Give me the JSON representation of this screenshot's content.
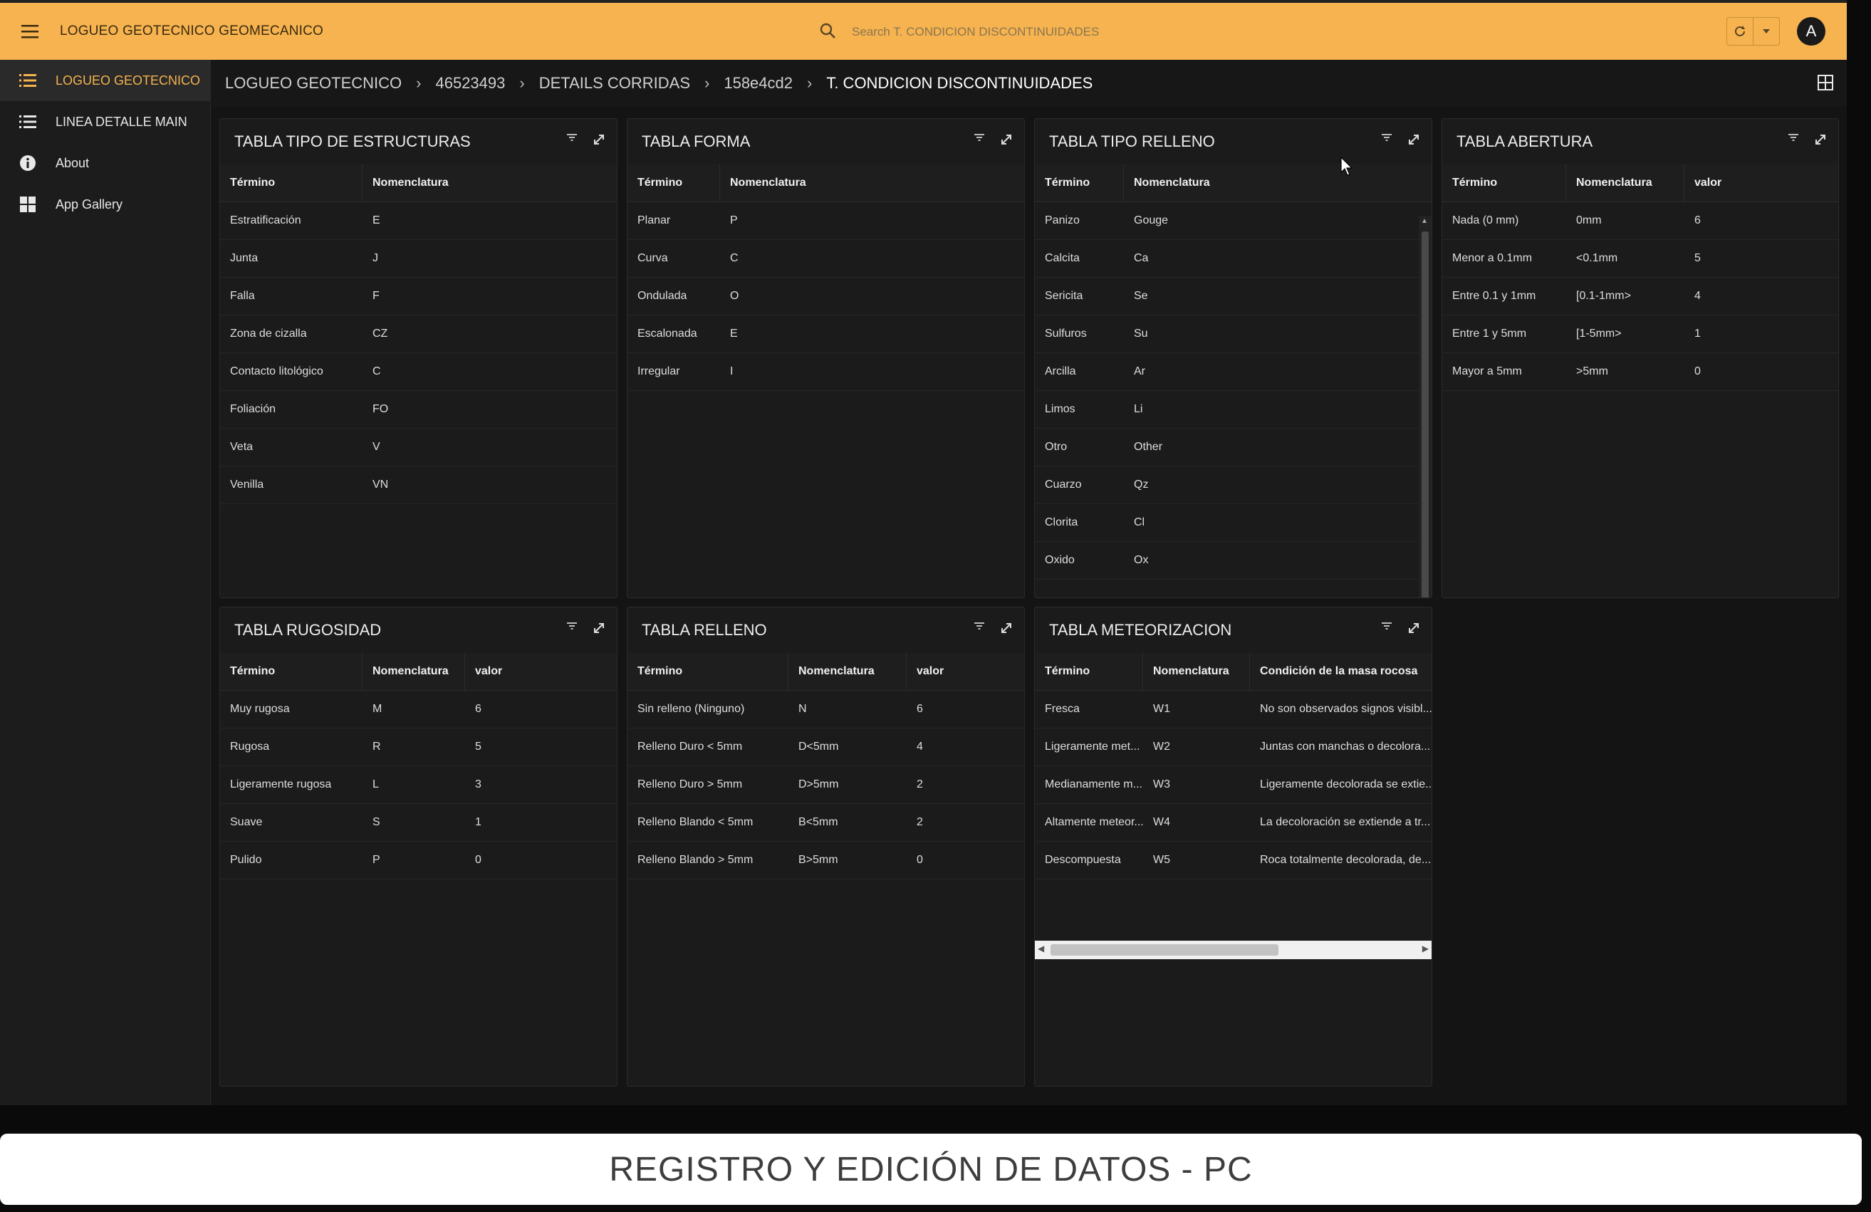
{
  "header": {
    "app_title": "LOGUEO GEOTECNICO GEOMECANICO",
    "search_placeholder": "Search T. CONDICION DISCONTINUIDADES",
    "avatar_letter": "A",
    "accent_color": "#f6b34f"
  },
  "sidebar": {
    "items": [
      {
        "label": "LOGUEO GEOTECNICO",
        "icon": "list-icon"
      },
      {
        "label": "LINEA DETALLE MAIN",
        "icon": "list-icon"
      },
      {
        "label": "About",
        "icon": "info-icon"
      },
      {
        "label": "App Gallery",
        "icon": "app-gallery-icon"
      }
    ]
  },
  "breadcrumb": [
    "LOGUEO GEOTECNICO",
    "46523493",
    "DETAILS CORRIDAS",
    "158e4cd2",
    "T. CONDICION DISCONTINUIDADES"
  ],
  "panels": {
    "estructuras": {
      "title": "TABLA TIPO DE ESTRUCTURAS",
      "columns": [
        "Término",
        "Nomenclatura"
      ],
      "rows": [
        [
          "Estratificación",
          "E"
        ],
        [
          "Junta",
          "J"
        ],
        [
          "Falla",
          "F"
        ],
        [
          "Zona de cizalla",
          "CZ"
        ],
        [
          "Contacto litológico",
          "C"
        ],
        [
          "Foliación",
          "FO"
        ],
        [
          "Veta",
          "V"
        ],
        [
          "Venilla",
          "VN"
        ]
      ]
    },
    "forma": {
      "title": "TABLA FORMA",
      "columns": [
        "Término",
        "Nomenclatura"
      ],
      "rows": [
        [
          "Planar",
          "P"
        ],
        [
          "Curva",
          "C"
        ],
        [
          "Ondulada",
          "O"
        ],
        [
          "Escalonada",
          "E"
        ],
        [
          "Irregular",
          "I"
        ]
      ]
    },
    "tipo_relleno": {
      "title": "TABLA TIPO RELLENO",
      "columns": [
        "Término",
        "Nomenclatura"
      ],
      "rows": [
        [
          "Panizo",
          "Gouge"
        ],
        [
          "Calcita",
          "Ca"
        ],
        [
          "Sericita",
          "Se"
        ],
        [
          "Sulfuros",
          "Su"
        ],
        [
          "Arcilla",
          "Ar"
        ],
        [
          "Limos",
          "Li"
        ],
        [
          "Otro",
          "Other"
        ],
        [
          "Cuarzo",
          "Qz"
        ],
        [
          "Clorita",
          "Cl"
        ],
        [
          "Oxido",
          "Ox"
        ]
      ]
    },
    "abertura": {
      "title": "TABLA ABERTURA",
      "columns": [
        "Término",
        "Nomenclatura",
        "valor"
      ],
      "rows": [
        [
          "Nada (0 mm)",
          "0mm",
          "6"
        ],
        [
          "Menor a 0.1mm",
          "<0.1mm",
          "5"
        ],
        [
          "Entre 0.1 y 1mm",
          "[0.1-1mm>",
          "4"
        ],
        [
          "Entre 1 y 5mm",
          "[1-5mm>",
          "1"
        ],
        [
          "Mayor a 5mm",
          ">5mm",
          "0"
        ]
      ]
    },
    "rugosidad": {
      "title": "TABLA RUGOSIDAD",
      "columns": [
        "Término",
        "Nomenclatura",
        "valor"
      ],
      "rows": [
        [
          "Muy rugosa",
          "M",
          "6"
        ],
        [
          "Rugosa",
          "R",
          "5"
        ],
        [
          "Ligeramente rugosa",
          "L",
          "3"
        ],
        [
          "Suave",
          "S",
          "1"
        ],
        [
          "Pulido",
          "P",
          "0"
        ]
      ]
    },
    "relleno": {
      "title": "TABLA RELLENO",
      "columns": [
        "Término",
        "Nomenclatura",
        "valor"
      ],
      "rows": [
        [
          "Sin relleno (Ninguno)",
          "N",
          "6"
        ],
        [
          "Relleno Duro < 5mm",
          "D<5mm",
          "4"
        ],
        [
          "Relleno Duro > 5mm",
          "D>5mm",
          "2"
        ],
        [
          "Relleno Blando < 5mm",
          "B<5mm",
          "2"
        ],
        [
          "Relleno Blando > 5mm",
          "B>5mm",
          "0"
        ]
      ]
    },
    "meteorizacion": {
      "title": "TABLA METEORIZACION",
      "columns": [
        "Término",
        "Nomenclatura",
        "Condición de la masa rocosa"
      ],
      "rows": [
        [
          "Fresca",
          "W1",
          "No son observados signos visibl..."
        ],
        [
          "Ligeramente met...",
          "W2",
          "Juntas con manchas o decolora..."
        ],
        [
          "Medianamente m...",
          "W3",
          "Ligeramente decolorada se extie..."
        ],
        [
          "Altamente meteor...",
          "W4",
          "La decoloración se extiende a tr..."
        ],
        [
          "Descompuesta",
          "W5",
          "Roca totalmente decolorada, de..."
        ]
      ]
    }
  },
  "banner": "REGISTRO Y EDICIÓN DE DATOS - PC"
}
